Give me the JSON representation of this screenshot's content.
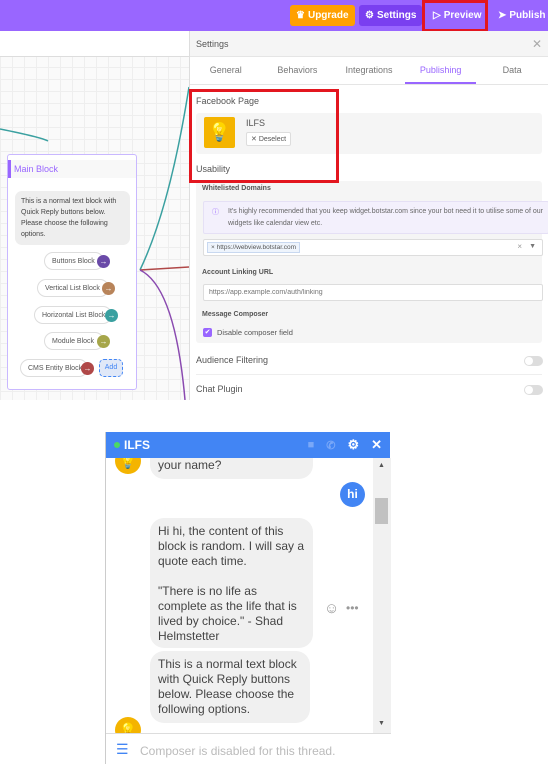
{
  "topbar": {
    "upgrade": "Upgrade",
    "settings": "Settings",
    "preview": "Preview",
    "publish": "Publish"
  },
  "colors": {
    "brand": "#9966ff",
    "upgrade": "#ffa000",
    "settings_btn": "#7a3ff0",
    "highlight": "#e3161f",
    "messenger": "#4285f4"
  },
  "canvas": {
    "main_block": {
      "title": "Main Block",
      "text": "This is a normal text block with Quick Reply buttons below. Please choose the following options.",
      "quick_replies": [
        {
          "label": "Buttons Block",
          "color": "#6a4aa8"
        },
        {
          "label": "Vertical List Block",
          "color": "#b8845a"
        },
        {
          "label": "Horizontal List Block",
          "color": "#3aa0a0"
        },
        {
          "label": "Module Block",
          "color": "#a6a64a"
        },
        {
          "label": "CMS Entity Block",
          "color": "#b04848"
        }
      ],
      "add": "Add"
    }
  },
  "settings": {
    "title": "Settings",
    "tabs": [
      "General",
      "Behaviors",
      "Integrations",
      "Publishing",
      "Data"
    ],
    "active_tab": "Publishing",
    "facebook_page": {
      "heading": "Facebook Page",
      "page_name": "ILFS",
      "deselect": "Deselect"
    },
    "usability": {
      "heading": "Usability",
      "whitelisted_label": "Whitelisted Domains",
      "info": "It's highly recommended that you keep widget.botstar.com since your bot need it to utilise some of our widgets like calendar view etc.",
      "domain_tag": "https://webview.botstar.com",
      "account_linking_label": "Account Linking URL",
      "account_linking_placeholder": "https://app.example.com/auth/linking",
      "composer_label": "Message Composer",
      "disable_composer": "Disable composer field",
      "disable_composer_checked": true
    },
    "audience_filtering": {
      "label": "Audience Filtering",
      "enabled": false
    },
    "chat_plugin": {
      "label": "Chat Plugin",
      "enabled": false
    }
  },
  "chat": {
    "title": "ILFS",
    "messages": [
      {
        "from": "bot",
        "text": "your name?"
      },
      {
        "from": "user",
        "text": "hi"
      },
      {
        "from": "bot",
        "text": "Hi hi, the content of this block is random. I will say a quote each time.\n\n\"There is no life as complete as the life that is lived by choice.\" - Shad Helmstetter"
      },
      {
        "from": "bot",
        "text": "This is a normal text block with Quick Reply buttons below. Please choose the following options."
      }
    ],
    "composer": "Composer is disabled for this thread."
  }
}
